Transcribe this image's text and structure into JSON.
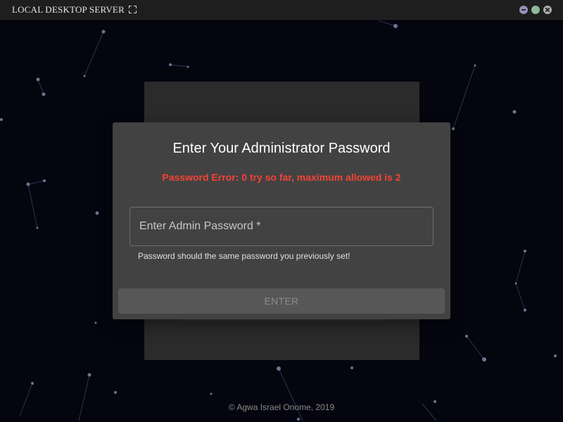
{
  "window": {
    "title": "LOCAL DESKTOP SERVER",
    "controls": [
      "minimize",
      "maximize",
      "close"
    ],
    "icons": {
      "fullscreen": "fullscreen-icon"
    }
  },
  "dialog": {
    "title": "Enter Your Administrator Password",
    "error": "Password Error: 0 try so far, maximum allowed is 2",
    "password_placeholder": "Enter Admin Password *",
    "password_value": "",
    "helper": "Password should the same password you previously set!",
    "submit_label": "ENTER"
  },
  "footer": {
    "copyright": "© Agwa Israel Onome, 2019"
  },
  "colors": {
    "background": "#05050f",
    "dialog": "#424242",
    "error": "#f44336",
    "minimize": "#9a8fb8",
    "maximize": "#8fb89a",
    "close": "#b0b0b0"
  }
}
